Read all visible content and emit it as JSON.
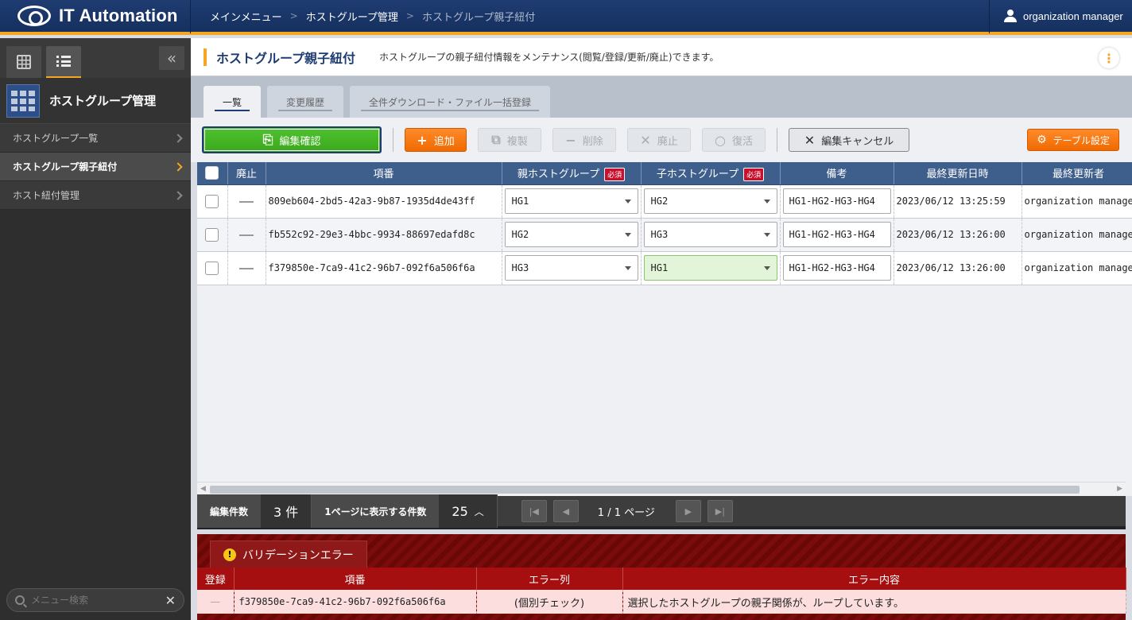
{
  "app": {
    "title": "IT Automation"
  },
  "breadcrumb": [
    "メインメニュー",
    "ホストグループ管理",
    "ホストグループ親子紐付"
  ],
  "user": {
    "name": "organization manager"
  },
  "sidebar": {
    "group_title": "ホストグループ管理",
    "items": [
      {
        "label": "ホストグループ一覧",
        "active": false
      },
      {
        "label": "ホストグループ親子紐付",
        "active": true
      },
      {
        "label": "ホスト紐付管理",
        "active": false
      }
    ],
    "search_placeholder": "メニュー検索"
  },
  "page": {
    "title": "ホストグループ親子紐付",
    "description": "ホストグループの親子紐付情報をメンテナンス(閲覧/登録/更新/廃止)できます。"
  },
  "tabs": [
    "一覧",
    "変更履歴",
    "全件ダウンロード・ファイル一括登録"
  ],
  "toolbar": {
    "edit_confirm": "編集確認",
    "add": "追加",
    "duplicate": "複製",
    "delete": "削除",
    "discard": "廃止",
    "restore": "復活",
    "edit_cancel": "編集キャンセル",
    "table_settings": "テーブル設定"
  },
  "grid": {
    "headers": {
      "discard": "廃止",
      "item_no": "項番",
      "parent": "親ホストグループ",
      "child": "子ホストグループ",
      "required": "必須",
      "remarks": "備考",
      "last_updated": "最終更新日時",
      "last_updater": "最終更新者"
    },
    "rows": [
      {
        "item_no": "809eb604-2bd5-42a3-9b87-1935d4de43ff",
        "parent": "HG1",
        "child": "HG2",
        "remarks": "HG1-HG2-HG3-HG4",
        "last_updated": "2023/06/12 13:25:59",
        "last_updater": "organization manager"
      },
      {
        "item_no": "fb552c92-29e3-4bbc-9934-88697edafd8c",
        "parent": "HG2",
        "child": "HG3",
        "remarks": "HG1-HG2-HG3-HG4",
        "last_updated": "2023/06/12 13:26:00",
        "last_updater": "organization manager"
      },
      {
        "item_no": "f379850e-7ca9-41c2-96b7-092f6a506f6a",
        "parent": "HG3",
        "child": "HG1",
        "remarks": "HG1-HG2-HG3-HG4",
        "last_updated": "2023/06/12 13:26:00",
        "last_updater": "organization manager"
      }
    ]
  },
  "pager": {
    "edit_count_label": "編集件数",
    "edit_count": "3 件",
    "per_page_label": "1ページに表示する件数",
    "per_page": "25",
    "page_info": "1 / 1 ページ"
  },
  "validation": {
    "tab_label": "バリデーションエラー",
    "headers": [
      "登録",
      "項番",
      "エラー列",
      "エラー内容"
    ],
    "rows": [
      {
        "register": "—",
        "item_no": "f379850e-7ca9-41c2-96b7-092f6a506f6a",
        "column": "(個別チェック)",
        "message": "選択したホストグループの親子関係が、ループしています。"
      }
    ]
  },
  "colors": {
    "accent": "#f5a623",
    "header": "#1f3c72",
    "primary": "#3aa81c",
    "warning": "#f06a00",
    "error": "#a50f0f"
  }
}
